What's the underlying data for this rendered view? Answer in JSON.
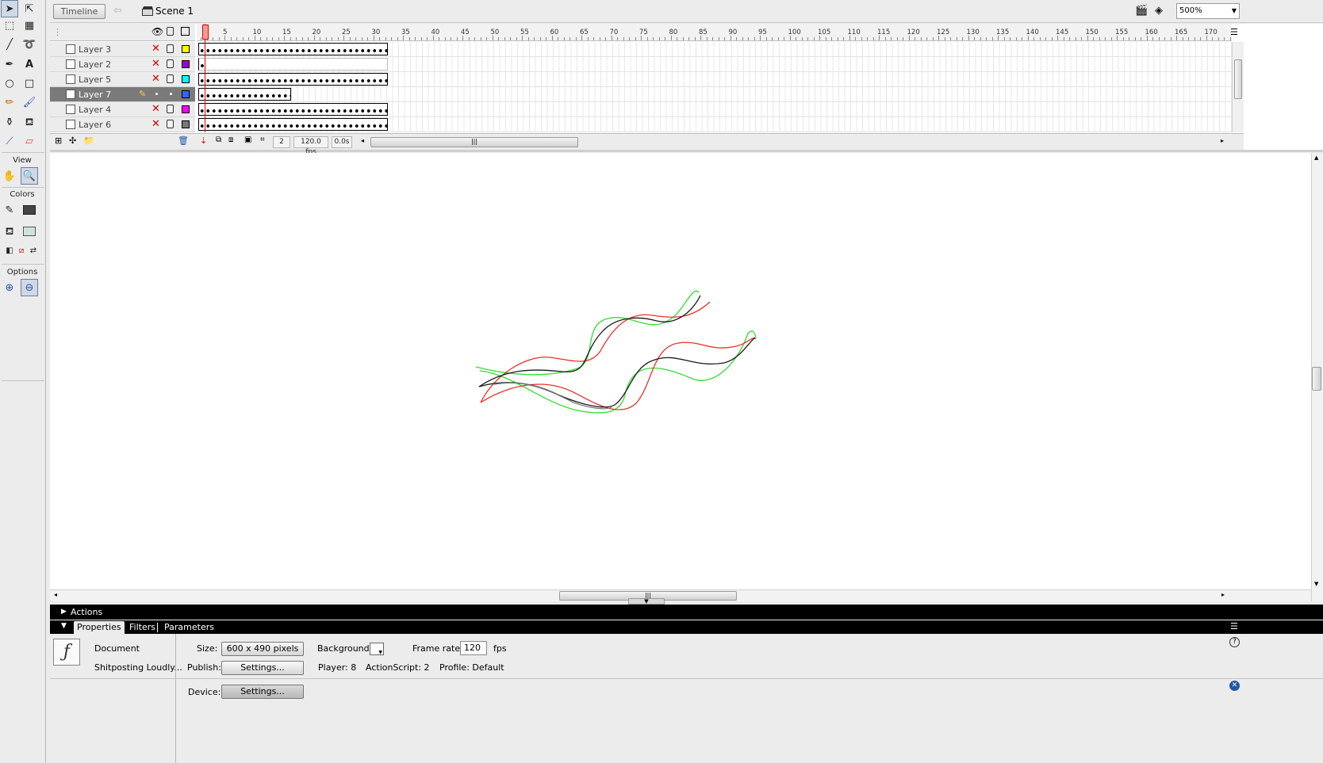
{
  "tools": {
    "view_label": "View",
    "colors_label": "Colors",
    "options_label": "Options"
  },
  "editbar": {
    "timeline_button": "Timeline",
    "scene_label": "Scene 1",
    "zoom": "500%"
  },
  "timeline": {
    "ruler_numbers": [
      "5",
      "10",
      "15",
      "20",
      "25",
      "30",
      "35",
      "40",
      "45",
      "50",
      "55",
      "60",
      "65",
      "70",
      "75",
      "80",
      "85",
      "90",
      "95",
      "100",
      "105",
      "110",
      "115",
      "120",
      "125",
      "130",
      "135",
      "140",
      "145",
      "150",
      "155",
      "160",
      "165",
      "170"
    ],
    "layers": [
      {
        "name": "Layer 3",
        "color": "#ffff00",
        "selected": false
      },
      {
        "name": "Layer 2",
        "color": "#9900cc",
        "selected": false
      },
      {
        "name": "Layer 5",
        "color": "#00ffff",
        "selected": false
      },
      {
        "name": "Layer 7",
        "color": "#3366ff",
        "selected": true
      },
      {
        "name": "Layer 4",
        "color": "#ff00ff",
        "selected": false
      },
      {
        "name": "Layer 6",
        "color": "#777777",
        "selected": false
      }
    ],
    "current_frame": "2",
    "frame_rate": "120.0 fps",
    "elapsed": "0.0s"
  },
  "panels": {
    "actions_label": "Actions",
    "tabs": [
      "Properties",
      "Filters",
      "Parameters"
    ],
    "doc_type": "Document",
    "doc_name": "Shitposting Loudly...",
    "size_label": "Size:",
    "size_value": "600 x 490 pixels",
    "background_label": "Background:",
    "frame_rate_label": "Frame rate:",
    "frame_rate_value": "120",
    "fps_label": "fps",
    "publish_label": "Publish:",
    "publish_button": "Settings...",
    "player_label": "Player: 8",
    "actionscript_label": "ActionScript: 2",
    "profile_label": "Profile: Default",
    "device_label": "Device:",
    "device_button": "Settings..."
  },
  "colors": {
    "stroke_black": "#1a1a1a",
    "stroke_red": "#e8302a",
    "stroke_green": "#33dd33",
    "panel_black": "#000000"
  }
}
